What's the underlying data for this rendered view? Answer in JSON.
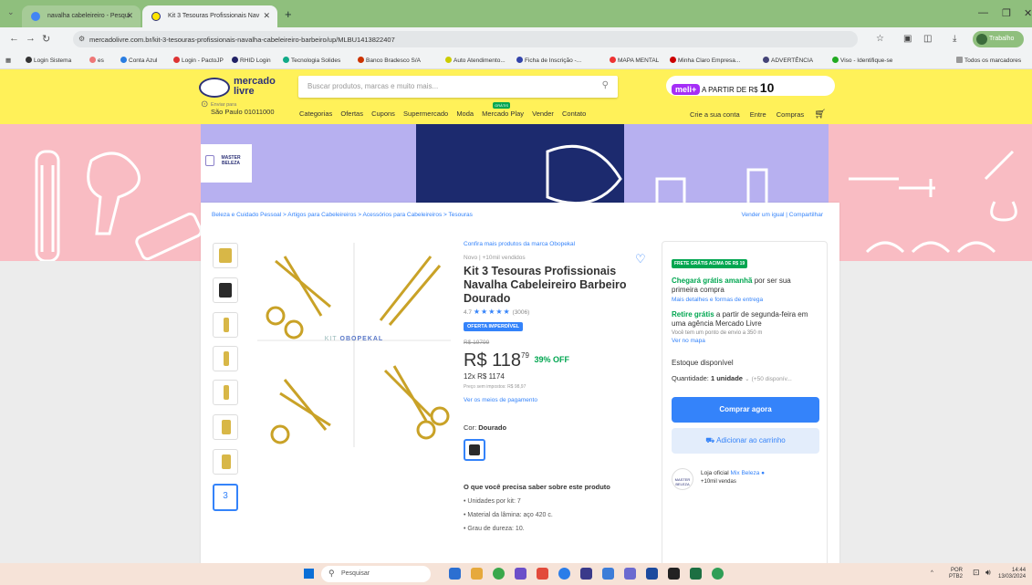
{
  "browser": {
    "tabs": [
      {
        "label": "navalha cabeleireiro - Pesqui",
        "active": false
      },
      {
        "label": "Kit 3 Tesouras Profissionais Nav",
        "active": true
      }
    ],
    "url": "mercadolivre.com.br/kit-3-tesouras-profissionais-navalha-cabeleireiro-barbeiro/up/MLBU1413822407",
    "profile": "Trabalho",
    "bookmarks": [
      "Login Sistema",
      "es",
      "Conta Azul",
      "Login - PactoJP",
      "RHID Login",
      "Tecnologia Solides",
      "Banco Bradesco S/A",
      "Auto Atendimento...",
      "Ficha de Inscrição -...",
      "MAPA MENTAL",
      "Minha Claro Empresa...",
      "ADVERTÊNCIA",
      "Viso - Identifique-se",
      "Todos os marcadores"
    ]
  },
  "header": {
    "logo_line1": "mercado",
    "logo_line2": "livre",
    "search_placeholder": "Buscar produtos, marcas e muito mais...",
    "meli_badge": "meli+",
    "meli_text": "A PARTIR DE R$",
    "meli_value": "10",
    "loc_line1": "Enviar para",
    "loc_line2": "São Paulo 01011000",
    "nav": [
      "Categorias",
      "Ofertas",
      "Cupons",
      "Supermercado",
      "Moda",
      "Mercado Play",
      "Vender",
      "Contato"
    ],
    "nav_right": [
      "Crie a sua conta",
      "Entre",
      "Compras"
    ]
  },
  "banner": {
    "brand_line1": "MASTER",
    "brand_line2": "BELEZA"
  },
  "product": {
    "breadcrumb": "Beleza e Cuidado Pessoal  >  Artigos para Cabeleireiros  >  Acessórios para Cabeleireiros  >  Tesouras",
    "breadcrumb_right": "Vender um igual  |  Compartilhar",
    "thumb_selected": "3",
    "kit_label_prefix": "KIT",
    "kit_label_brand": "OBOPEKAL",
    "more_brand": "Confira mais produtos da marca Obopekal",
    "condition": "Novo  |  +10mil vendidos",
    "title": "Kit 3 Tesouras Profissionais Navalha Cabeleireiro Barbeiro Dourado",
    "rating_value": "4.7",
    "rating_stars": "★★★★★",
    "rating_count": "(3006)",
    "oferta": "OFERTA IMPERDÍVEL",
    "old_price": "R$ 19799",
    "price_main": "R$ 118",
    "price_cents": "79",
    "discount": "39% OFF",
    "installments": "12x R$ 1174",
    "no_interest": "Preço sem impostos: R$ 98,97",
    "payment_link": "Ver os meios de pagamento",
    "color_label": "Cor:",
    "color_value": "Dourado",
    "saber_title": "O que você precisa saber sobre este produto",
    "bullets": [
      "Unidades por kit: 7",
      "Material da lâmina: aço 420 c.",
      "Grau de dureza: 10."
    ]
  },
  "buybox": {
    "free_badge": "FRETE GRÁTIS ACIMA DE R$ 19",
    "ship_bold": "Chegará grátis amanhã",
    "ship_rest": " por ser sua primeira compra",
    "ship_link": "Mais detalhes e formas de entrega",
    "pickup_bold": "Retire grátis",
    "pickup_rest": " a partir de segunda-feira em uma agência Mercado Livre",
    "pickup_small": "Você tem um ponto de envio a 350 m",
    "map_link": "Ver no mapa",
    "stock": "Estoque disponível",
    "qty_label": "Quantidade:",
    "qty_value": "1 unidade",
    "qty_avail": "(+50 disponív...",
    "buy_btn": "Comprar agora",
    "cart_btn": "Adicionar ao carrinho",
    "store_prefix": "Loja oficial",
    "store_name": "Mix Beleza",
    "store_sales": "+10mil vendas",
    "store_avatar": "MASTER BELEZA"
  },
  "taskbar": {
    "search": "Pesquisar",
    "lang1": "POR",
    "lang2": "PTB2",
    "time": "14:44",
    "date": "13/03/2024"
  },
  "colors": {
    "ml_yellow": "#fff159",
    "ml_blue": "#3483fa",
    "green": "#00a650",
    "tab_green": "#8fbf7d"
  }
}
